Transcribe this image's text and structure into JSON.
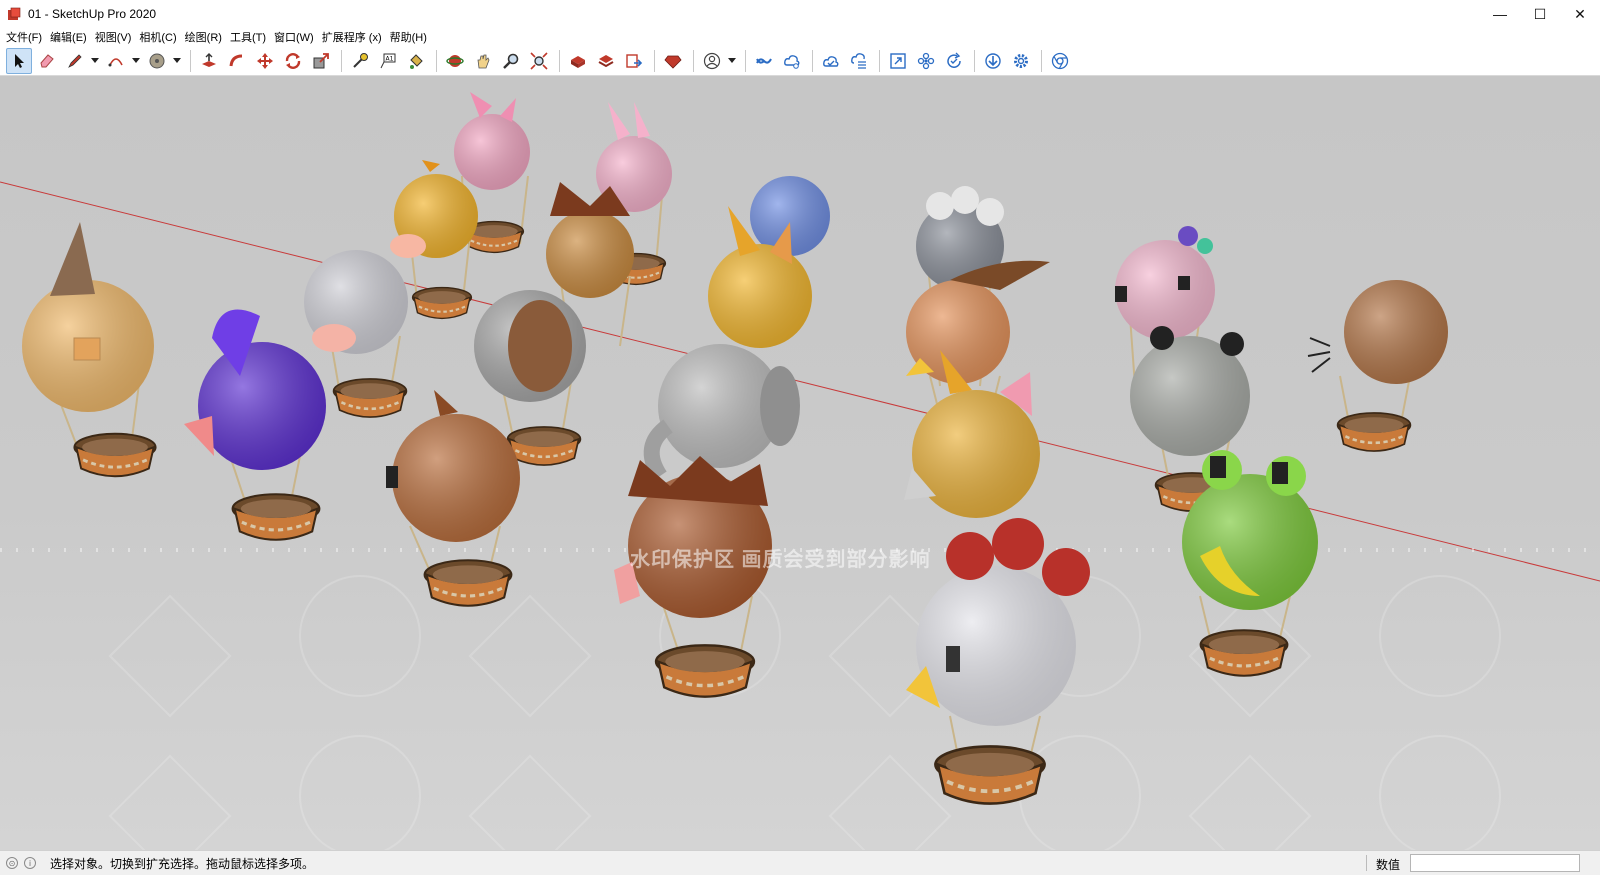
{
  "window": {
    "title": "01 - SketchUp Pro 2020",
    "controls": {
      "minimize": "—",
      "maximize": "☐",
      "close": "✕"
    }
  },
  "menu": [
    "文件(F)",
    "编辑(E)",
    "视图(V)",
    "相机(C)",
    "绘图(R)",
    "工具(T)",
    "窗口(W)",
    "扩展程序 (x)",
    "帮助(H)"
  ],
  "toolbar": {
    "groups": [
      [
        "select-tool",
        "eraser-tool",
        "pencil-line-tool",
        "arc-tool",
        "shape-tool"
      ],
      [
        "push-pull-tool",
        "follow-me-tool",
        "move-tool",
        "rotate-tool",
        "scale-tool"
      ],
      [
        "tape-measure-tool",
        "text-tool",
        "paint-bucket-tool"
      ],
      [
        "orbit-tool",
        "pan-tool",
        "zoom-tool",
        "zoom-extents-tool"
      ],
      [
        "3d-warehouse-tool",
        "extension-warehouse-tool",
        "layout-send-tool"
      ],
      [
        "ruby-extension-tool"
      ],
      [
        "profile-tool"
      ],
      [
        "trimble-connect-tool",
        "trimble-share-tool",
        "cloud-sync-tool",
        "cloud-list-tool"
      ],
      [
        "fit-view-tool",
        "components-tool",
        "refresh-tool"
      ],
      [
        "download-tool",
        "settings-tool",
        "chrome-tool"
      ]
    ]
  },
  "viewport": {
    "watermark": "水印保护区   画质会受到部分影响"
  },
  "status": {
    "message": "选择对象。切换到扩充选择。拖动鼠标选择多项。",
    "vcb_label": "数值",
    "vcb_value": ""
  },
  "colors": {
    "axis_red": "#c83a3a",
    "viewport_bg": "#c8c8c8",
    "selection_blue": "#cfe3f7"
  }
}
